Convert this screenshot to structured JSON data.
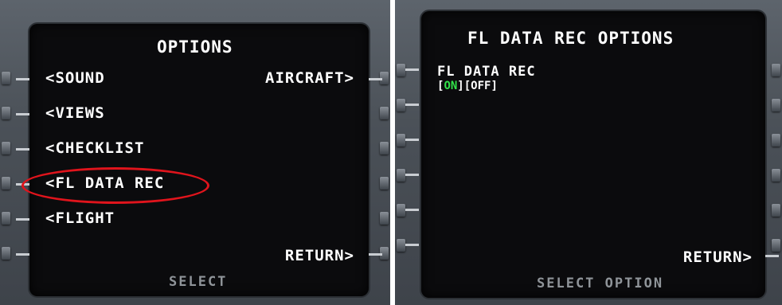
{
  "left_screen": {
    "title": "OPTIONS",
    "items": {
      "sound": "<SOUND",
      "aircraft": "AIRCRAFT>",
      "views": "<VIEWS",
      "checklist": "<CHECKLIST",
      "fl_data_rec": "<FL DATA REC",
      "flight": "<FLIGHT",
      "return": "RETURN>"
    },
    "scratchpad": "SELECT",
    "highlight_color": "#e0141c"
  },
  "right_screen": {
    "title": "FL DATA REC OPTIONS",
    "setting_label": "FL DATA REC",
    "toggle": {
      "on": "ON",
      "off": "OFF",
      "active": "on",
      "active_color": "#32e24a"
    },
    "return": "RETURN>",
    "scratchpad": "SELECT OPTION"
  }
}
